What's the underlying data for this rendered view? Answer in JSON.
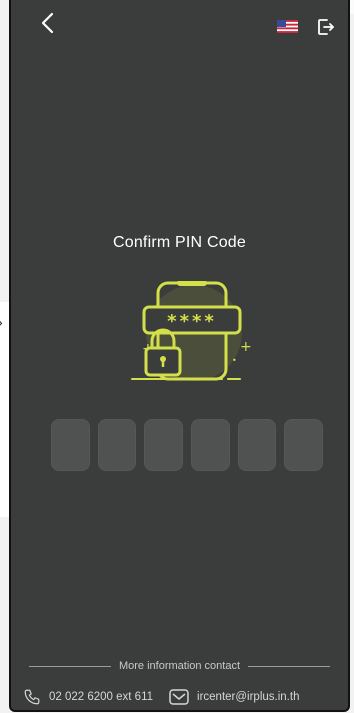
{
  "header": {
    "back_icon": "chevron-left-icon",
    "language_flag": "us-flag-icon",
    "logout_icon": "logout-icon"
  },
  "main": {
    "title": "Confirm PIN Code",
    "illustration_mask": "****",
    "pin_length": 6
  },
  "footer": {
    "contact_label": "More information contact",
    "phone": "02 022 6200 ext 611",
    "email": "ircenter@irplus.in.th"
  },
  "colors": {
    "background": "#3b3c3c",
    "accent": "#d4e04a",
    "pin_box": "#505151",
    "text": "#ffffff"
  }
}
